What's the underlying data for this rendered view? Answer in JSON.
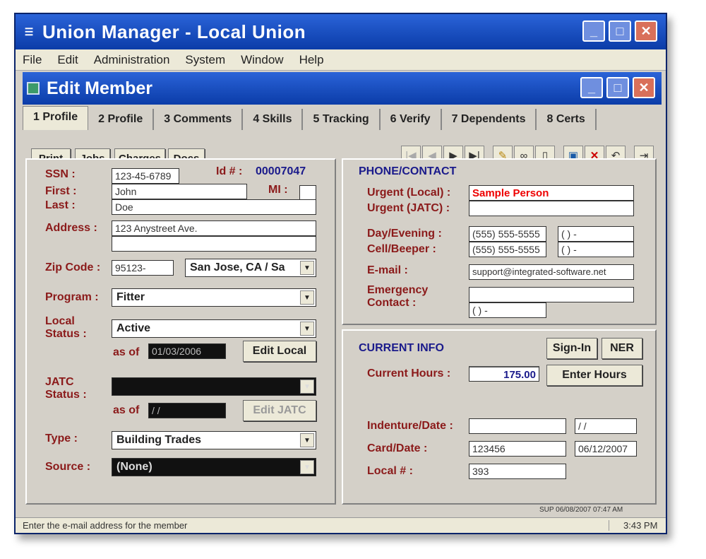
{
  "window": {
    "title": "Union Manager - Local Union"
  },
  "menu": [
    "File",
    "Edit",
    "Administration",
    "System",
    "Window",
    "Help"
  ],
  "child": {
    "title": "Edit Member"
  },
  "tabs": [
    "1 Profile",
    "2 Profile",
    "3 Comments",
    "4 Skills",
    "5 Tracking",
    "6 Verify",
    "7 Dependents",
    "8 Certs"
  ],
  "subbuttons": [
    "Print",
    "Jobs",
    "Charges",
    "Docs"
  ],
  "left": {
    "ssn_label": "SSN :",
    "ssn": "123-45-6789",
    "id_label": "Id # :",
    "id": "00007047",
    "first_label": "First :",
    "first": "John",
    "mi_label": "MI :",
    "mi": "",
    "last_label": "Last :",
    "last": "Doe",
    "address_label": "Address :",
    "address1": "123 Anystreet Ave.",
    "address2": "",
    "zip_label": "Zip Code :",
    "zip": "95123-",
    "city": "San Jose, CA / Sa",
    "program_label": "Program :",
    "program": "Fitter",
    "local_label_1": "Local",
    "local_label_2": "Status :",
    "local_status": "Active",
    "asof_label": "as of",
    "local_asof": "01/03/2006",
    "edit_local": "Edit Local",
    "jatc_label_1": "JATC",
    "jatc_label_2": "Status :",
    "jatc_status": "",
    "jatc_asof": " / /",
    "edit_jatc": "Edit JATC",
    "type_label": "Type :",
    "type": "Building Trades",
    "source_label": "Source :",
    "source": "(None)"
  },
  "phone": {
    "title": "PHONE/CONTACT",
    "urgent_local_label": "Urgent (Local) :",
    "urgent_local": "Sample Person",
    "urgent_jatc_label": "Urgent (JATC) :",
    "urgent_jatc": "",
    "day_label": "Day/Evening :",
    "day1": "(555) 555-5555",
    "day2": "(   )   -",
    "cell_label": "Cell/Beeper :",
    "cell1": "(555) 555-5555",
    "cell2": "(   )   -",
    "email_label": "E-mail :",
    "email": "support@integrated-software.net",
    "emergency_label_1": "Emergency",
    "emergency_label_2": "Contact :",
    "emergency_name": "",
    "emergency_phone": "(   )   -"
  },
  "current": {
    "title": "CURRENT INFO",
    "signin": "Sign-In",
    "ner": "NER",
    "hours_label": "Current Hours :",
    "hours": "175.00",
    "enter_hours": "Enter Hours",
    "indenture_label": "Indenture/Date :",
    "indenture": "",
    "indenture_date": " / /",
    "card_label": "Card/Date :",
    "card": "123456",
    "card_date": "06/12/2007",
    "local_num_label": "Local # :",
    "local_num": "393"
  },
  "stamp": "SUP 06/08/2007 07:47 AM",
  "status": {
    "message": "Enter the e-mail address for the member",
    "time": "3:43 PM"
  }
}
